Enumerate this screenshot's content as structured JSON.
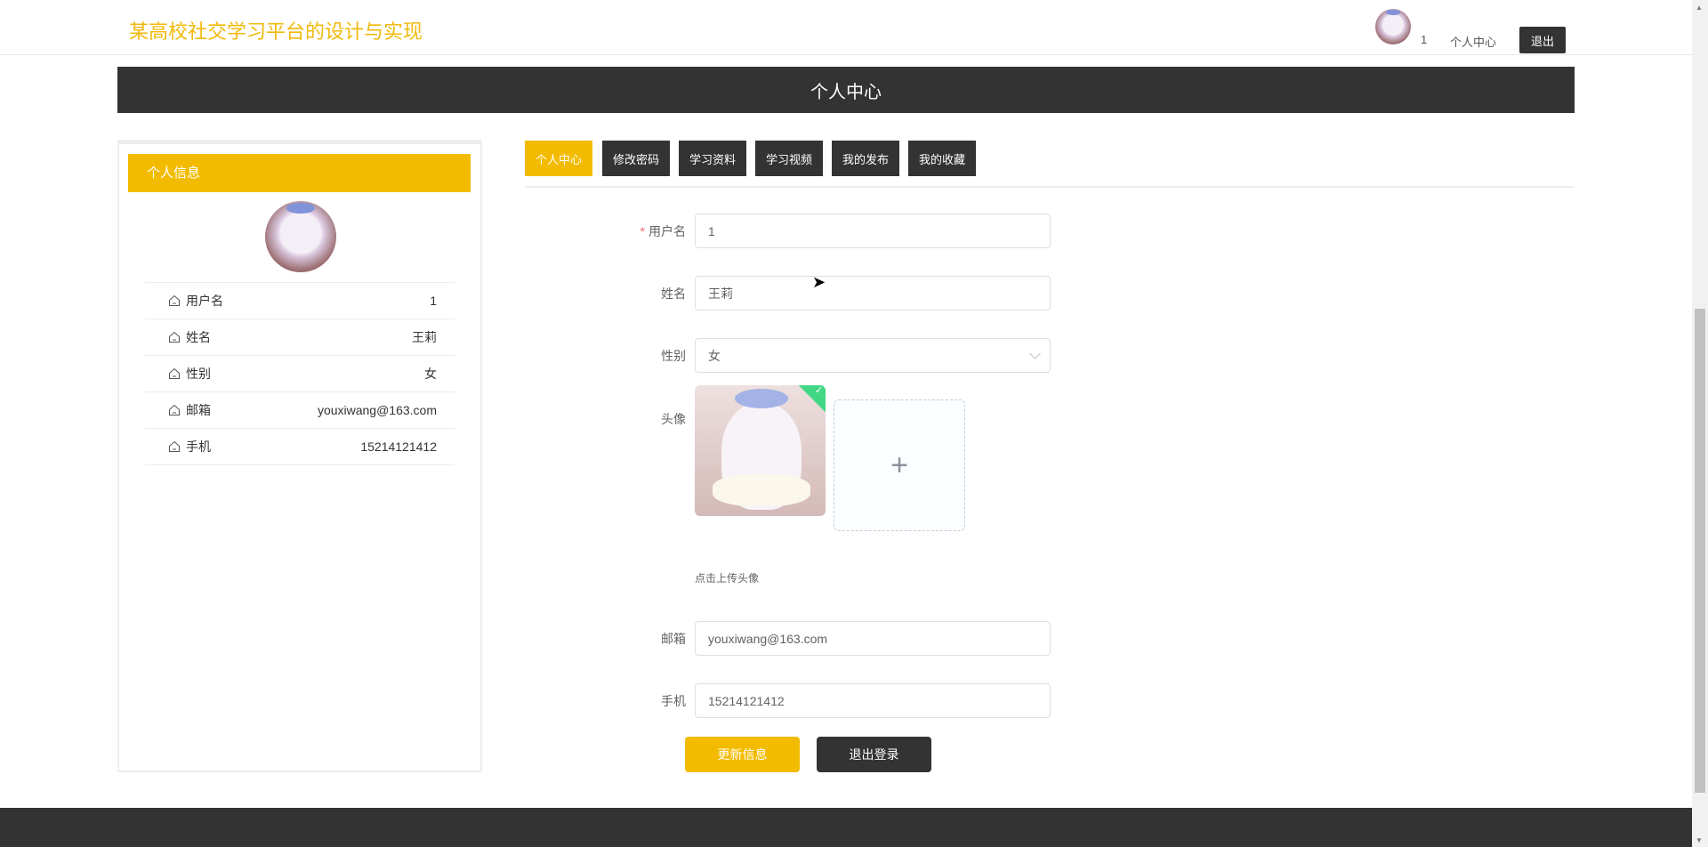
{
  "header": {
    "site_title": "某高校社交学习平台的设计与实现",
    "username": "1",
    "profile_link": "个人中心",
    "logout": "退出"
  },
  "banner": {
    "title": "个人中心"
  },
  "info_card": {
    "title": "个人信息",
    "rows": [
      {
        "label": "用户名",
        "value": "1"
      },
      {
        "label": "姓名",
        "value": "王莉"
      },
      {
        "label": "性别",
        "value": "女"
      },
      {
        "label": "邮箱",
        "value": "youxiwang@163.com"
      },
      {
        "label": "手机",
        "value": "15214121412"
      }
    ]
  },
  "tabs": [
    {
      "label": "个人中心"
    },
    {
      "label": "修改密码"
    },
    {
      "label": "学习资料"
    },
    {
      "label": "学习视频"
    },
    {
      "label": "我的发布"
    },
    {
      "label": "我的收藏"
    }
  ],
  "form": {
    "required_mark": "*",
    "username_label": "用户名",
    "username_value": "1",
    "name_label": "姓名",
    "name_value": "王莉",
    "gender_label": "性别",
    "gender_value": "女",
    "avatar_label": "头像",
    "upload_plus": "+",
    "upload_hint": "点击上传头像",
    "email_label": "邮箱",
    "email_value": "youxiwang@163.com",
    "phone_label": "手机",
    "phone_value": "15214121412",
    "update_button": "更新信息",
    "logout_button": "退出登录",
    "success_check": "✓"
  },
  "colors": {
    "accent": "#f3bb00",
    "dark": "#333333",
    "title": "#f0b90b"
  }
}
